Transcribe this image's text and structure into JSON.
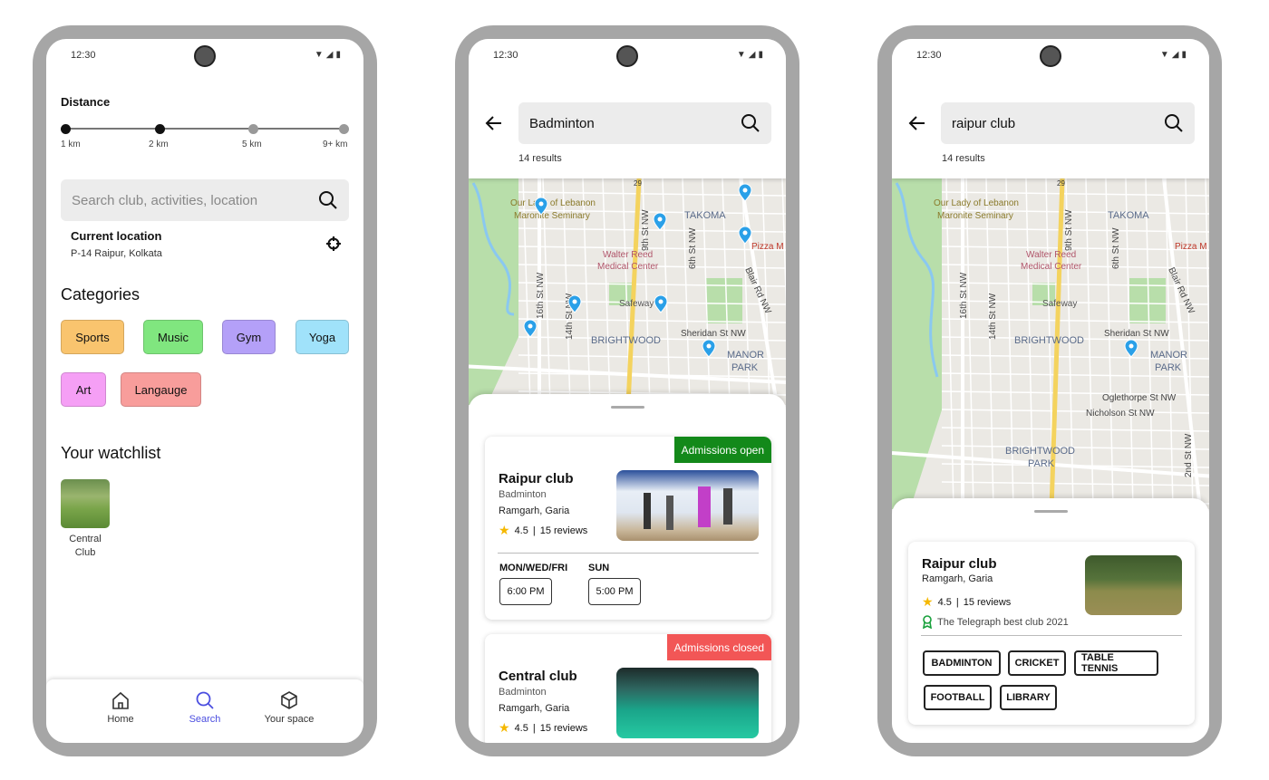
{
  "status": {
    "time": "12:30"
  },
  "phone1": {
    "distance": {
      "label": "Distance",
      "stops": [
        "1 km",
        "2 km",
        "5 km",
        "9+ km"
      ],
      "selected_up_to": "2 km"
    },
    "search": {
      "placeholder": "Search club, activities, location"
    },
    "location": {
      "title": "Current location",
      "address": "P-14 Raipur, Kolkata"
    },
    "categories": {
      "title": "Categories",
      "items": [
        {
          "label": "Sports",
          "color": "#f9c46e"
        },
        {
          "label": "Music",
          "color": "#80e67f"
        },
        {
          "label": "Gym",
          "color": "#b4a0f8"
        },
        {
          "label": "Yoga",
          "color": "#a0e2fa"
        },
        {
          "label": "Art",
          "color": "#f59ff5"
        },
        {
          "label": "Langauge",
          "color": "#f89d9b"
        }
      ]
    },
    "watchlist": {
      "title": "Your watchlist",
      "items": [
        {
          "name": "Central Club"
        }
      ]
    },
    "nav": [
      {
        "label": "Home",
        "icon": "home-icon"
      },
      {
        "label": "Search",
        "icon": "search-icon",
        "active": true
      },
      {
        "label": "Your space",
        "icon": "cube-icon"
      }
    ],
    "accent": "#4b4ee0"
  },
  "map_labels": {
    "seminary1": "Our Lady of Lebanon",
    "seminary2": "Maronite Seminary",
    "takoma": "TAKOMA",
    "walter1": "Walter Reed",
    "walter2": "Medical Center",
    "safeway": "Safeway",
    "brightwood": "BRIGHTWOOD",
    "manor": "MANOR",
    "park": "PARK",
    "sheridan": "Sheridan St NW",
    "st16": "16th St NW",
    "st14": "14th St NW",
    "st9": "9th St NW",
    "st6": "6th St NW",
    "blair": "Blair Rd NW",
    "pizza": "Pizza M",
    "route": "29",
    "oglethorpe": "Oglethorpe St NW",
    "nicholson": "Nicholson St NW",
    "bpark1": "BRIGHTWOOD",
    "bpark2": "PARK",
    "st2": "2nd St NW"
  },
  "phone2": {
    "search": {
      "value": "Badminton"
    },
    "results": "14 results",
    "cards": [
      {
        "name": "Raipur club",
        "activity": "Badminton",
        "location": "Ramgarh, Garia",
        "rating": "4.5",
        "reviews": "15 reviews",
        "badge": "Admissions open",
        "badge_color": "#13891a",
        "schedule": [
          {
            "days": "MON/WED/FRI",
            "time": "6:00 PM"
          },
          {
            "days": "SUN",
            "time": "5:00 PM"
          }
        ]
      },
      {
        "name": "Central club",
        "activity": "Badminton",
        "location": "Ramgarh, Garia",
        "rating": "4.5",
        "reviews": "15 reviews",
        "badge": "Admissions closed",
        "badge_color": "#f25656"
      }
    ]
  },
  "phone3": {
    "search": {
      "value": "raipur club"
    },
    "results": "14 results",
    "card": {
      "name": "Raipur club",
      "location": "Ramgarh, Garia",
      "rating": "4.5",
      "reviews": "15 reviews",
      "award": "The Telegraph best club 2021",
      "tags": [
        "BADMINTON",
        "CRICKET",
        "TABLE TENNIS",
        "FOOTBALL",
        "LIBRARY"
      ]
    }
  }
}
